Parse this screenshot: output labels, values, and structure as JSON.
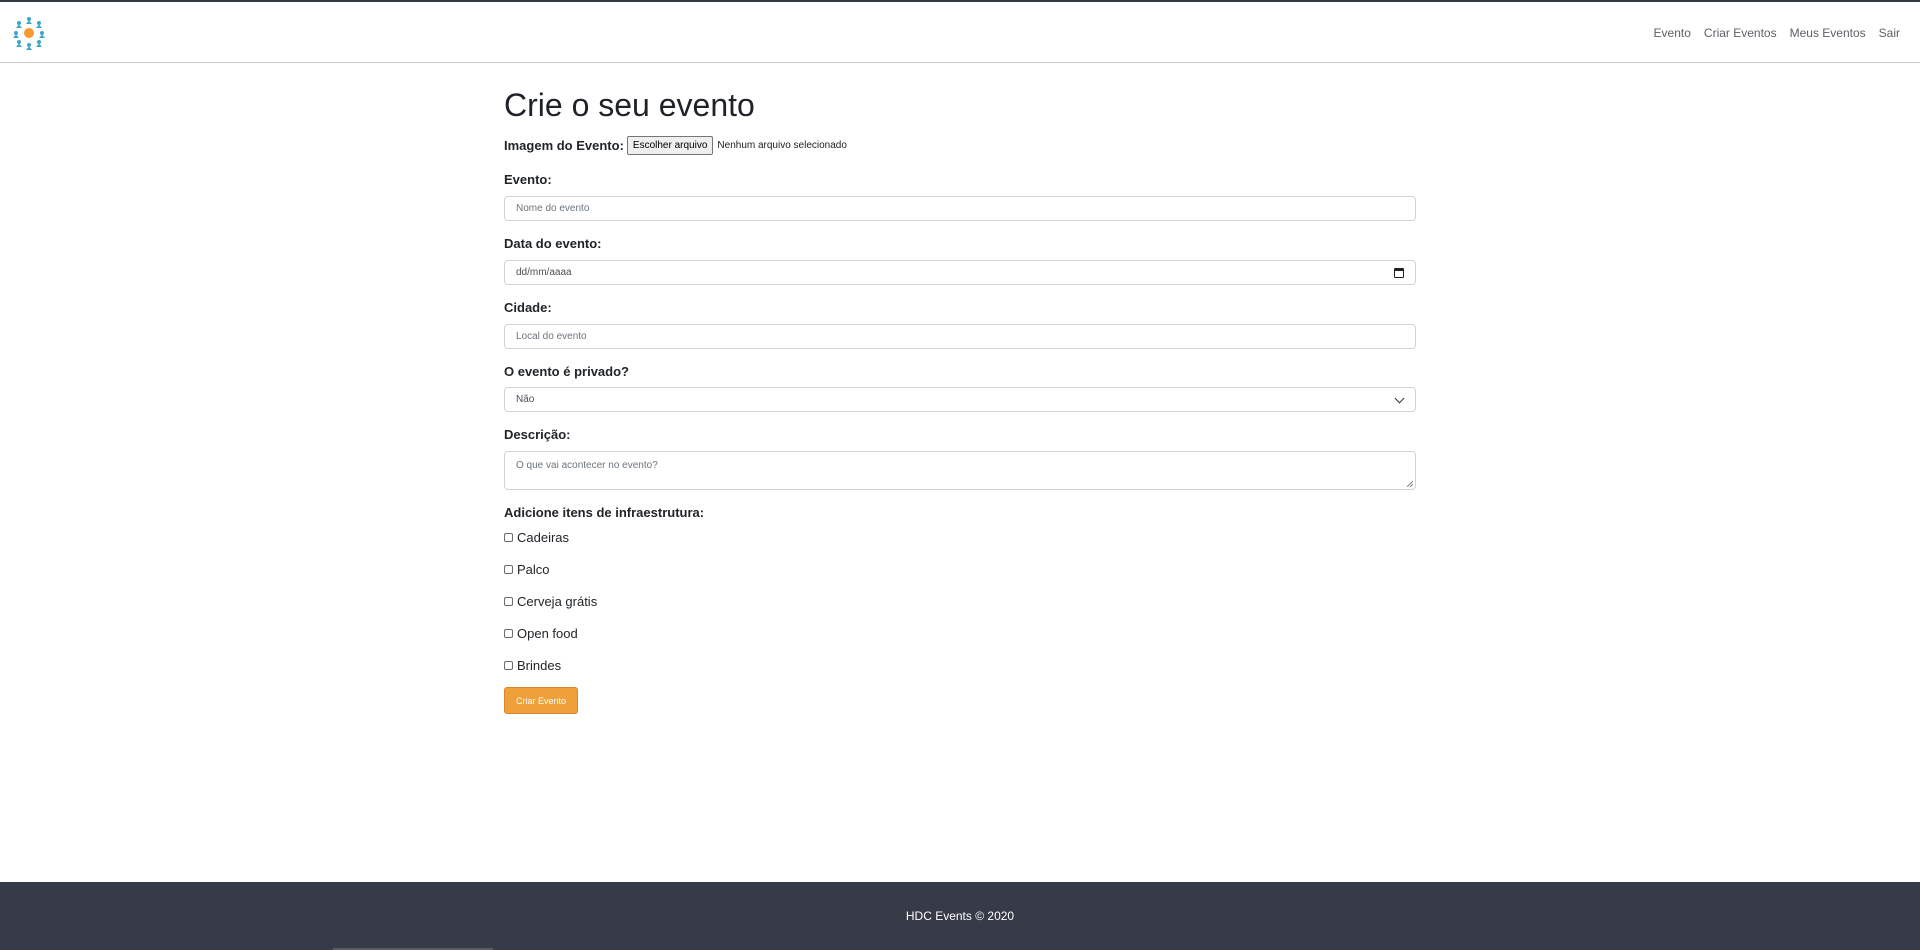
{
  "nav": {
    "logo_icon": "people-network-icon",
    "links": [
      "Evento",
      "Criar Eventos",
      "Meus Eventos",
      "Sair"
    ]
  },
  "form": {
    "title": "Crie o seu evento",
    "image": {
      "label": "Imagem do Evento:",
      "button": "Escolher arquivo",
      "status": "Nenhum arquivo selecionado"
    },
    "event": {
      "label": "Evento:",
      "placeholder": "Nome do evento"
    },
    "date": {
      "label": "Data do evento:",
      "placeholder": "dd/mm/aaaa"
    },
    "city": {
      "label": "Cidade:",
      "placeholder": "Local do evento"
    },
    "private": {
      "label": "O evento é privado?",
      "selected": "Não"
    },
    "description": {
      "label": "Descrição:",
      "placeholder": "O que vai acontecer no evento?"
    },
    "infra": {
      "label": "Adicione itens de infraestrutura:",
      "items": [
        "Cadeiras",
        "Palco",
        "Cerveja grátis",
        "Open food",
        "Brindes"
      ]
    },
    "submit": "Criar Evento"
  },
  "footer": {
    "text": "HDC Events © 2020"
  },
  "colors": {
    "accent": "#f0a03a",
    "footer_bg": "#363b47",
    "logo_blue": "#3aa6c8",
    "logo_orange": "#f29b30"
  }
}
